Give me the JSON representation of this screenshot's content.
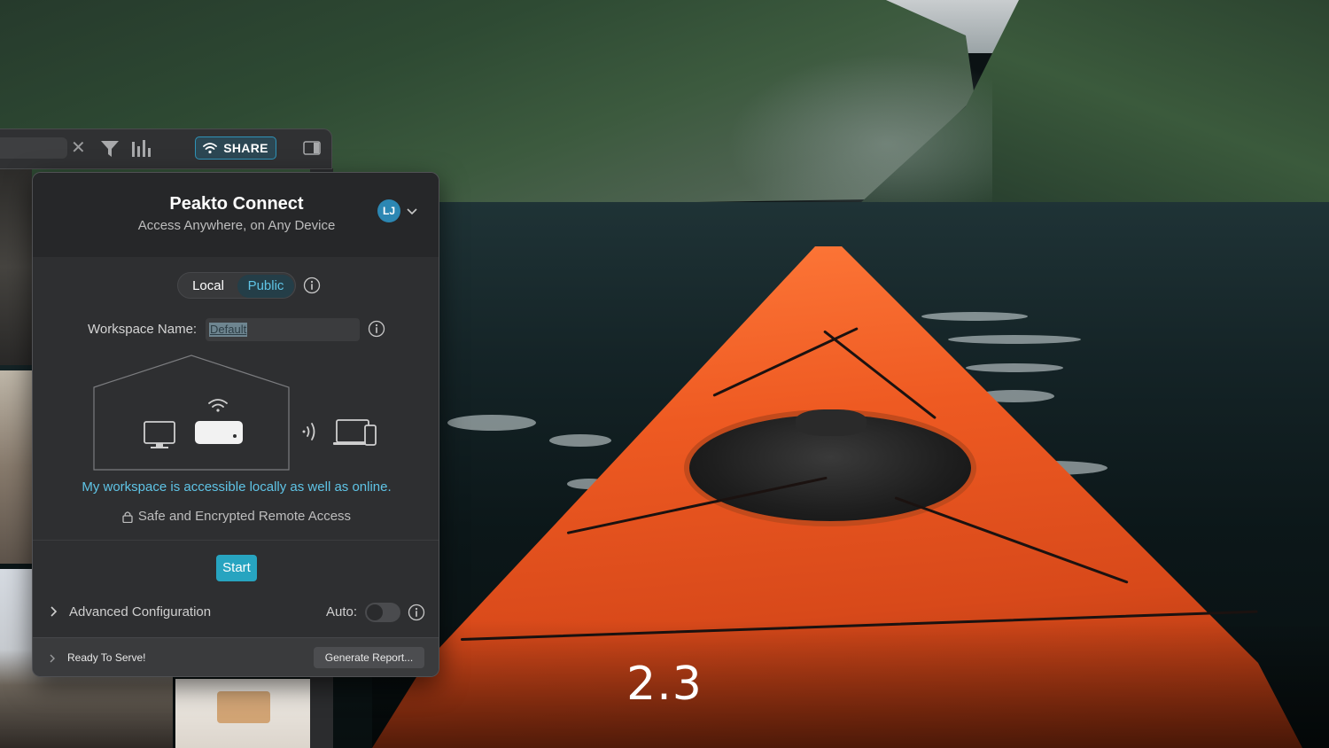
{
  "toolbar": {
    "share_label": "SHARE"
  },
  "popover": {
    "title": "Peakto Connect",
    "subtitle": "Access Anywhere, on Any Device",
    "avatar_initials": "LJ",
    "modes": [
      {
        "label": "Local",
        "selected": false
      },
      {
        "label": "Public",
        "selected": true
      }
    ],
    "workspace": {
      "label": "Workspace Name:",
      "value": "Default"
    },
    "access_message": "My workspace is accessible locally as well as online.",
    "secure_message": "Safe and Encrypted Remote Access",
    "start_label": "Start",
    "advanced_label": "Advanced Configuration",
    "auto_label": "Auto:",
    "auto_enabled": false,
    "footer": {
      "status": "Ready To Serve!",
      "report_label": "Generate Report..."
    }
  },
  "version": "2.3",
  "colors": {
    "accent": "#27a4c0",
    "accent_text": "#5fc4e6",
    "panel_bg": "#2e2f31"
  }
}
